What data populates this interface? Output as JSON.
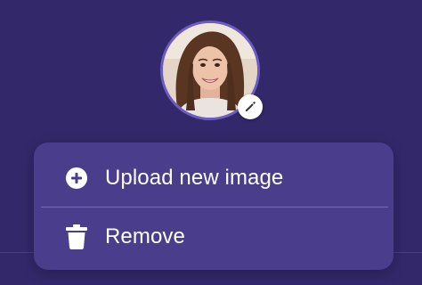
{
  "profile": {
    "avatar_icon": "profile-photo",
    "edit_icon": "pencil-icon"
  },
  "menu": {
    "items": [
      {
        "label": "Upload new image",
        "icon": "plus-circle-icon"
      },
      {
        "label": "Remove",
        "icon": "trash-icon"
      }
    ]
  },
  "colors": {
    "background": "#33286a",
    "menu_background": "#4a3d8c",
    "avatar_ring": "#6b5cc4",
    "text": "#ffffff"
  }
}
